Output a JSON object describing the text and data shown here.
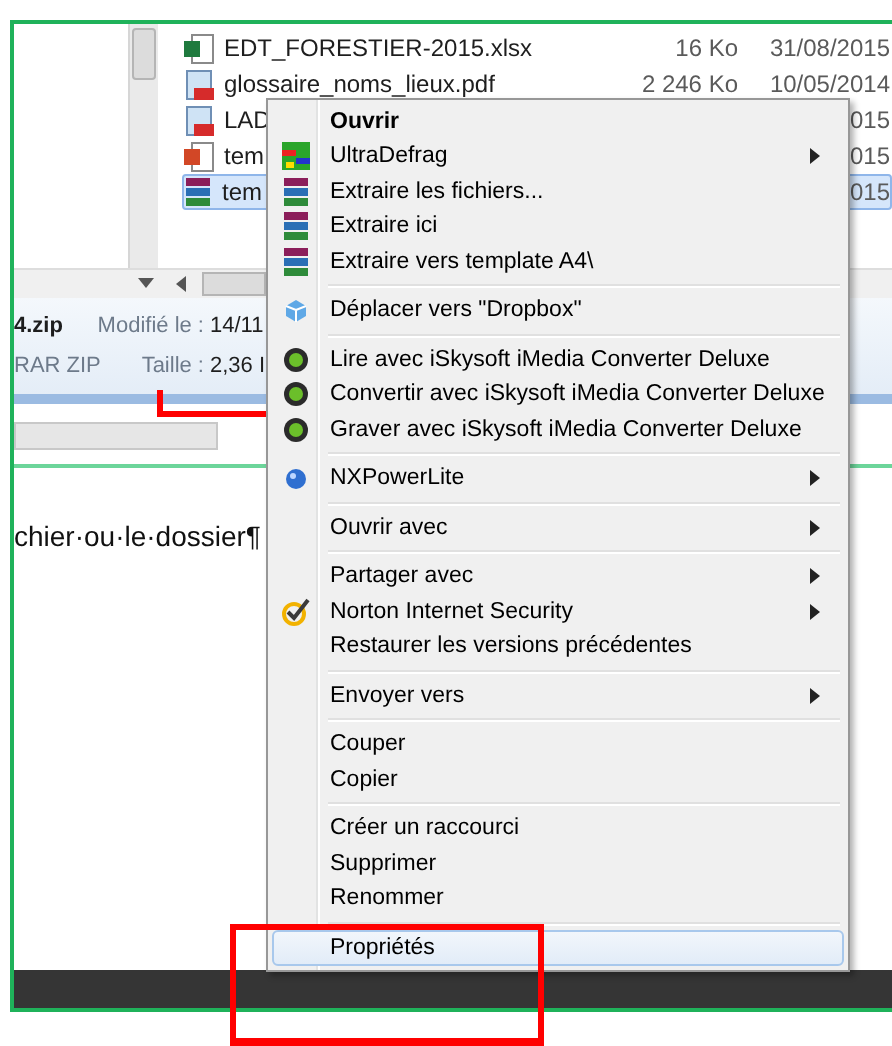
{
  "files": [
    {
      "kind": "spreadsheet",
      "name": "EDT_FORESTIER-2015.xlsx",
      "size": "16 Ko",
      "date": "31/08/2015",
      "selected": false
    },
    {
      "kind": "pdf",
      "name": "glossaire_noms_lieux.pdf",
      "size": "2 246 Ko",
      "date": "10/05/2014",
      "selected": false
    },
    {
      "kind": "pdf",
      "name": "LAD",
      "date": "015",
      "selected": false
    },
    {
      "kind": "presentation",
      "name": "tem",
      "date": "015",
      "selected": false
    },
    {
      "kind": "archive",
      "name": "tem",
      "date": "015",
      "selected": true
    }
  ],
  "details": {
    "name": "4.zip",
    "type": "RAR ZIP",
    "modified_label": "Modifié le :",
    "modified": "14/11",
    "size_label": "Taille :",
    "size": "2,36 I"
  },
  "document_text": "chier·ou·le·dossier¶",
  "context_menu": [
    [
      {
        "kind": "plain",
        "label": "Ouvrir",
        "bold": true
      },
      {
        "kind": "defrag",
        "label": "UltraDefrag",
        "submenu": true
      },
      {
        "kind": "archive",
        "label": "Extraire les fichiers..."
      },
      {
        "kind": "archive",
        "label": "Extraire ici"
      },
      {
        "kind": "archive",
        "label": "Extraire vers template A4\\"
      }
    ],
    [
      {
        "kind": "dropbox",
        "label": "Déplacer vers \"Dropbox\""
      }
    ],
    [
      {
        "kind": "media",
        "label": "Lire avec iSkysoft iMedia Converter Deluxe"
      },
      {
        "kind": "media",
        "label": "Convertir avec iSkysoft iMedia Converter Deluxe"
      },
      {
        "kind": "media",
        "label": "Graver avec iSkysoft iMedia Converter Deluxe"
      }
    ],
    [
      {
        "kind": "sphere",
        "label": "NXPowerLite",
        "submenu": true
      }
    ],
    [
      {
        "kind": "plain",
        "label": "Ouvrir avec",
        "submenu": true
      }
    ],
    [
      {
        "kind": "plain",
        "label": "Partager avec",
        "submenu": true
      },
      {
        "kind": "check",
        "label": "Norton Internet Security",
        "submenu": true
      },
      {
        "kind": "plain",
        "label": "Restaurer les versions précédentes"
      }
    ],
    [
      {
        "kind": "plain",
        "label": "Envoyer vers",
        "submenu": true
      }
    ],
    [
      {
        "kind": "plain",
        "label": "Couper"
      },
      {
        "kind": "plain",
        "label": "Copier"
      }
    ],
    [
      {
        "kind": "plain",
        "label": "Créer un raccourci"
      },
      {
        "kind": "plain",
        "label": "Supprimer"
      },
      {
        "kind": "plain",
        "label": "Renommer"
      }
    ],
    [
      {
        "kind": "plain",
        "label": "Propriétés",
        "highlighted": true
      }
    ]
  ]
}
